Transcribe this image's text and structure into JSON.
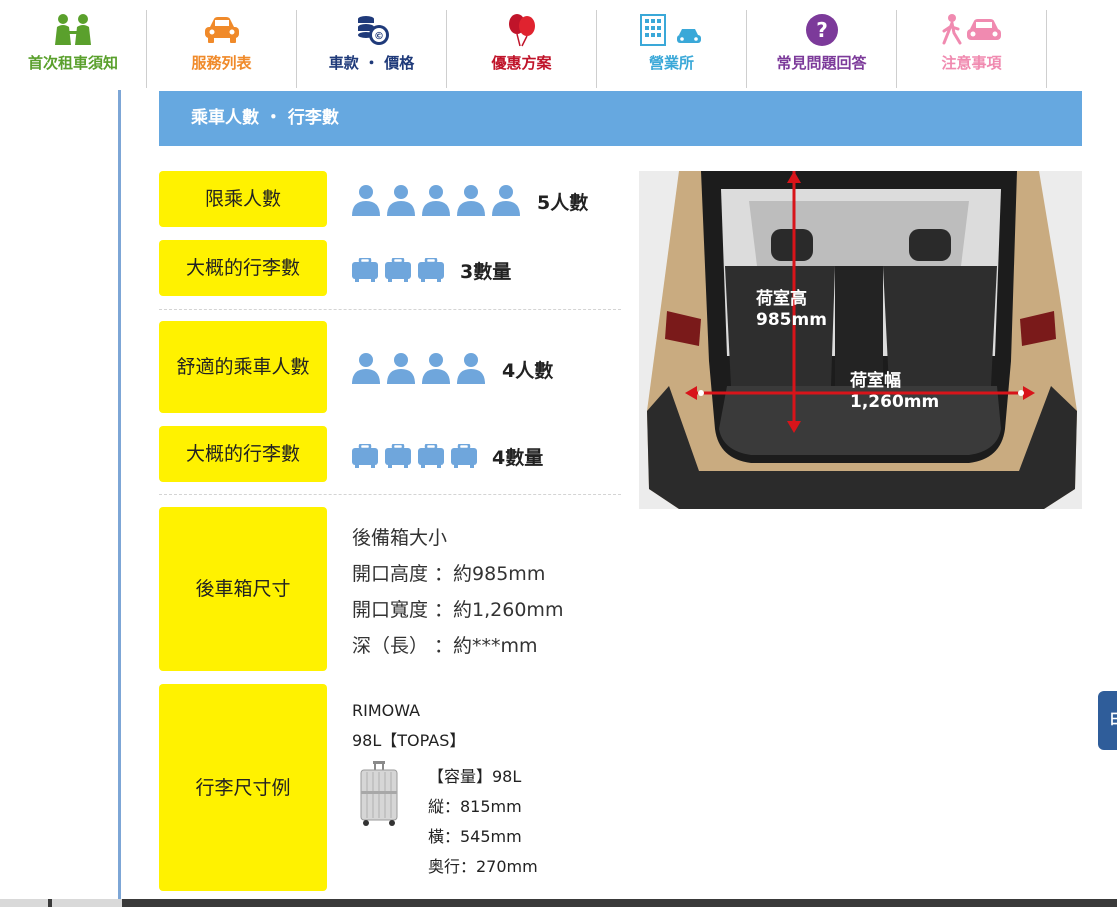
{
  "nav": {
    "items": [
      {
        "label": "首次租車須知",
        "icon": "two-people-icon",
        "color": "#5aa02c"
      },
      {
        "label": "服務列表",
        "icon": "car-icon",
        "color": "#f08a2a"
      },
      {
        "label": "車款 ・ 價格",
        "icon": "coins-icon",
        "color": "#1f3a7a"
      },
      {
        "label": "優惠方案",
        "icon": "balloon-icon",
        "color": "#c0142a"
      },
      {
        "label": "營業所",
        "icon": "building-car-icon",
        "color": "#3aa8d8"
      },
      {
        "label": "常見問題回答",
        "icon": "question-icon",
        "color": "#7c3a9a"
      },
      {
        "label": "注意事項",
        "icon": "pedestrian-car-icon",
        "color": "#f08ab0"
      }
    ]
  },
  "section": {
    "title": "乘車人數 ・ 行李數"
  },
  "rows": {
    "max_passengers": {
      "label": "限乘人數",
      "count": 5,
      "value": "5人數"
    },
    "luggage_a": {
      "label": "大概的行李數",
      "count": 3,
      "value": "3數量"
    },
    "comfort_passengers": {
      "label": "舒適的乘車人數",
      "count": 4,
      "value": "4人數"
    },
    "luggage_b": {
      "label": "大概的行李數",
      "count": 4,
      "value": "4數量"
    }
  },
  "trunk": {
    "label": "後車箱尺寸",
    "lines": [
      "後備箱大小",
      "開口高度 ：約985mm",
      "開口寬度 ：約1,260mm",
      "深（長） ：約***mm"
    ]
  },
  "luggage_example": {
    "label": "行李尺寸例",
    "brand": "RIMOWA",
    "model": "98L【TOPAS】",
    "specs": [
      "【容量】98L",
      "縦：815mm",
      "橫：545mm",
      "奥行：270mm"
    ]
  },
  "car_photo": {
    "height_label": "荷室高",
    "height_value": "985mm",
    "width_label": "荷室幅",
    "width_value": "1,260mm"
  },
  "side_tab": {
    "label": "日"
  },
  "colors": {
    "accent_blue": "#66a8e0",
    "label_yellow": "#fff200",
    "icon_blue": "#6fa6dc",
    "arrow_red": "#d8141a"
  }
}
